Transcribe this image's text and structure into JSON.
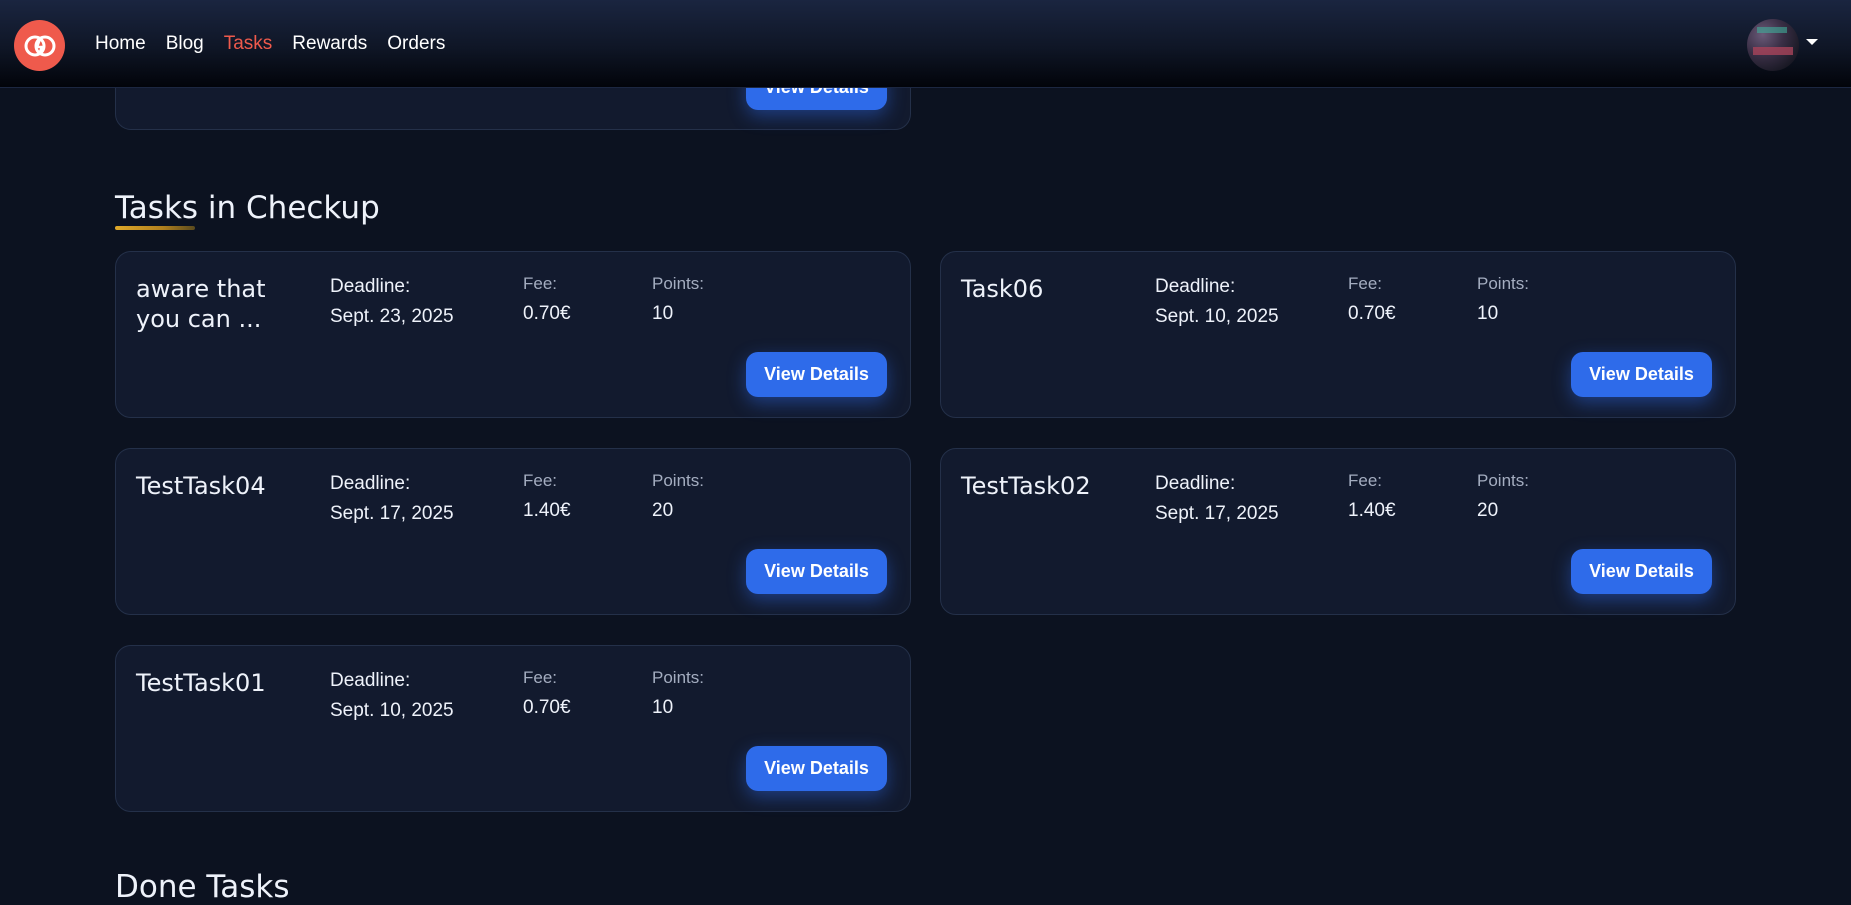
{
  "nav": {
    "links": [
      {
        "label": "Home"
      },
      {
        "label": "Blog"
      },
      {
        "label": "Tasks"
      },
      {
        "label": "Rewards"
      },
      {
        "label": "Orders"
      }
    ],
    "active": "Tasks"
  },
  "top_card": {
    "button_label": "View Details"
  },
  "section": {
    "title": "Tasks in Checkup"
  },
  "labels": {
    "deadline": "Deadline:",
    "fee": "Fee:",
    "points": "Points:",
    "view_details": "View Details"
  },
  "tasks": [
    {
      "title": "aware that you can ...",
      "deadline": "Sept. 23, 2025",
      "fee": "0.70€",
      "points": "10"
    },
    {
      "title": "Task06",
      "deadline": "Sept. 10, 2025",
      "fee": "0.70€",
      "points": "10"
    },
    {
      "title": "TestTask04",
      "deadline": "Sept. 17, 2025",
      "fee": "1.40€",
      "points": "20"
    },
    {
      "title": "TestTask02",
      "deadline": "Sept. 17, 2025",
      "fee": "1.40€",
      "points": "20"
    },
    {
      "title": "TestTask01",
      "deadline": "Sept. 10, 2025",
      "fee": "0.70€",
      "points": "10"
    }
  ],
  "next_section": {
    "title": "Done Tasks"
  },
  "colors": {
    "accent": "#ef5a4c",
    "button": "#2e6bea",
    "background": "#0c1220",
    "card": "#121a2e"
  }
}
